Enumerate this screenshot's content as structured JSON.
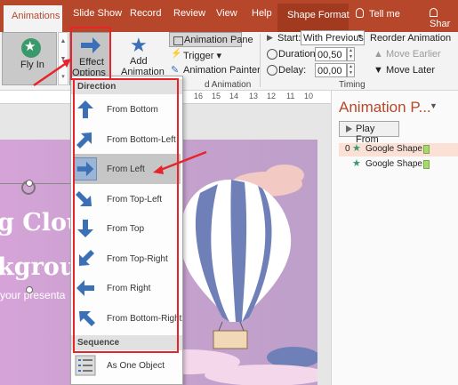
{
  "tabs": [
    "Animations",
    "Slide Show",
    "Record",
    "Review",
    "View",
    "Help",
    "Shape Format"
  ],
  "tell_me": "Tell me",
  "share": "Shar",
  "ribbon": {
    "fly_in": "Fly In",
    "effect_l1": "Effect",
    "effect_l2": "Options",
    "add_l1": "Add",
    "add_l2": "Animation",
    "anim_pane": "Animation Pane",
    "trigger": "Trigger",
    "painter": "Animation Painter",
    "group_anim": "d Animation",
    "start_label": "Start:",
    "start_value": "With Previous",
    "duration_label": "Duration:",
    "duration_value": "00,50",
    "delay_label": "Delay:",
    "delay_value": "00,00",
    "group_timing": "Timing",
    "reorder": "Reorder Animation",
    "move_earlier": "Move Earlier",
    "move_later": "Move Later"
  },
  "ruler": [
    "16",
    "15",
    "14",
    "13",
    "12",
    "11",
    "10"
  ],
  "slide": {
    "title1": "g Clou",
    "title2": "kgrou",
    "subtitle": "your presenta"
  },
  "pane": {
    "title": "Animation P...",
    "play_from": "Play From",
    "items": [
      {
        "num": "0",
        "name": "Google Shape..."
      },
      {
        "num": "",
        "name": "Google Shape..."
      }
    ]
  },
  "menu": {
    "direction_header": "Direction",
    "options": [
      "From Bottom",
      "From Bottom-Left",
      "From Left",
      "From Top-Left",
      "From Top",
      "From Top-Right",
      "From Right",
      "From Bottom-Right"
    ],
    "selected": "From Left",
    "sequence_header": "Sequence",
    "sequence_option": "As One Object"
  },
  "colors": {
    "accent": "#b7472a",
    "highlight_red": "#e8232a",
    "icon_blue": "#3b6fb6",
    "green": "#3a9a6c"
  }
}
